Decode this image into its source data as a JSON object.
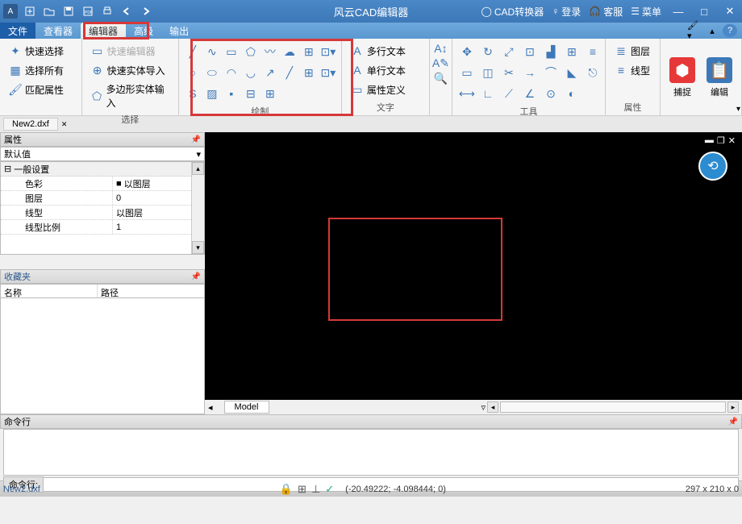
{
  "title": "风云CAD编辑器",
  "title_right": {
    "converter": "CAD转换器",
    "login": "登录",
    "service": "客服",
    "menu": "菜单"
  },
  "menus": [
    "文件",
    "查看器",
    "编辑器",
    "高级",
    "输出"
  ],
  "ribbon": {
    "select": {
      "quick_select": "快速选择",
      "select_all": "选择所有",
      "match_props": "匹配属性",
      "fast_entity_import": "快速实体导入",
      "poly_entity_input": "多边形实体输入",
      "quick_editor": "快速编辑器",
      "label": "选择"
    },
    "draw": {
      "label": "绘制"
    },
    "text": {
      "mtext": "多行文本",
      "stext": "单行文本",
      "attdef": "属性定义",
      "label": "文字"
    },
    "tools": {
      "label": "工具"
    },
    "layers": {
      "layer": "图层",
      "linetype": "线型",
      "label": "属性"
    },
    "snap": "捕捉",
    "edit": "编辑"
  },
  "file_tab": "New2.dxf",
  "props_panel": {
    "title": "属性",
    "dropdown": "默认值",
    "section": "一般设置",
    "rows": [
      {
        "k": "色彩",
        "v": "以图层"
      },
      {
        "k": "图层",
        "v": "0"
      },
      {
        "k": "线型",
        "v": "以图层"
      },
      {
        "k": "线型比例",
        "v": "1"
      }
    ]
  },
  "fav_panel": {
    "title": "收藏夹",
    "col1": "名称",
    "col2": "路径"
  },
  "model_tab": "Model",
  "cmd_panel": {
    "title": "命令行",
    "prompt": "命令行:"
  },
  "status": {
    "file": "New2.dxf",
    "coords": "(-20.49222; -4.098444; 0)",
    "dims": "297 x 210 x 0"
  }
}
